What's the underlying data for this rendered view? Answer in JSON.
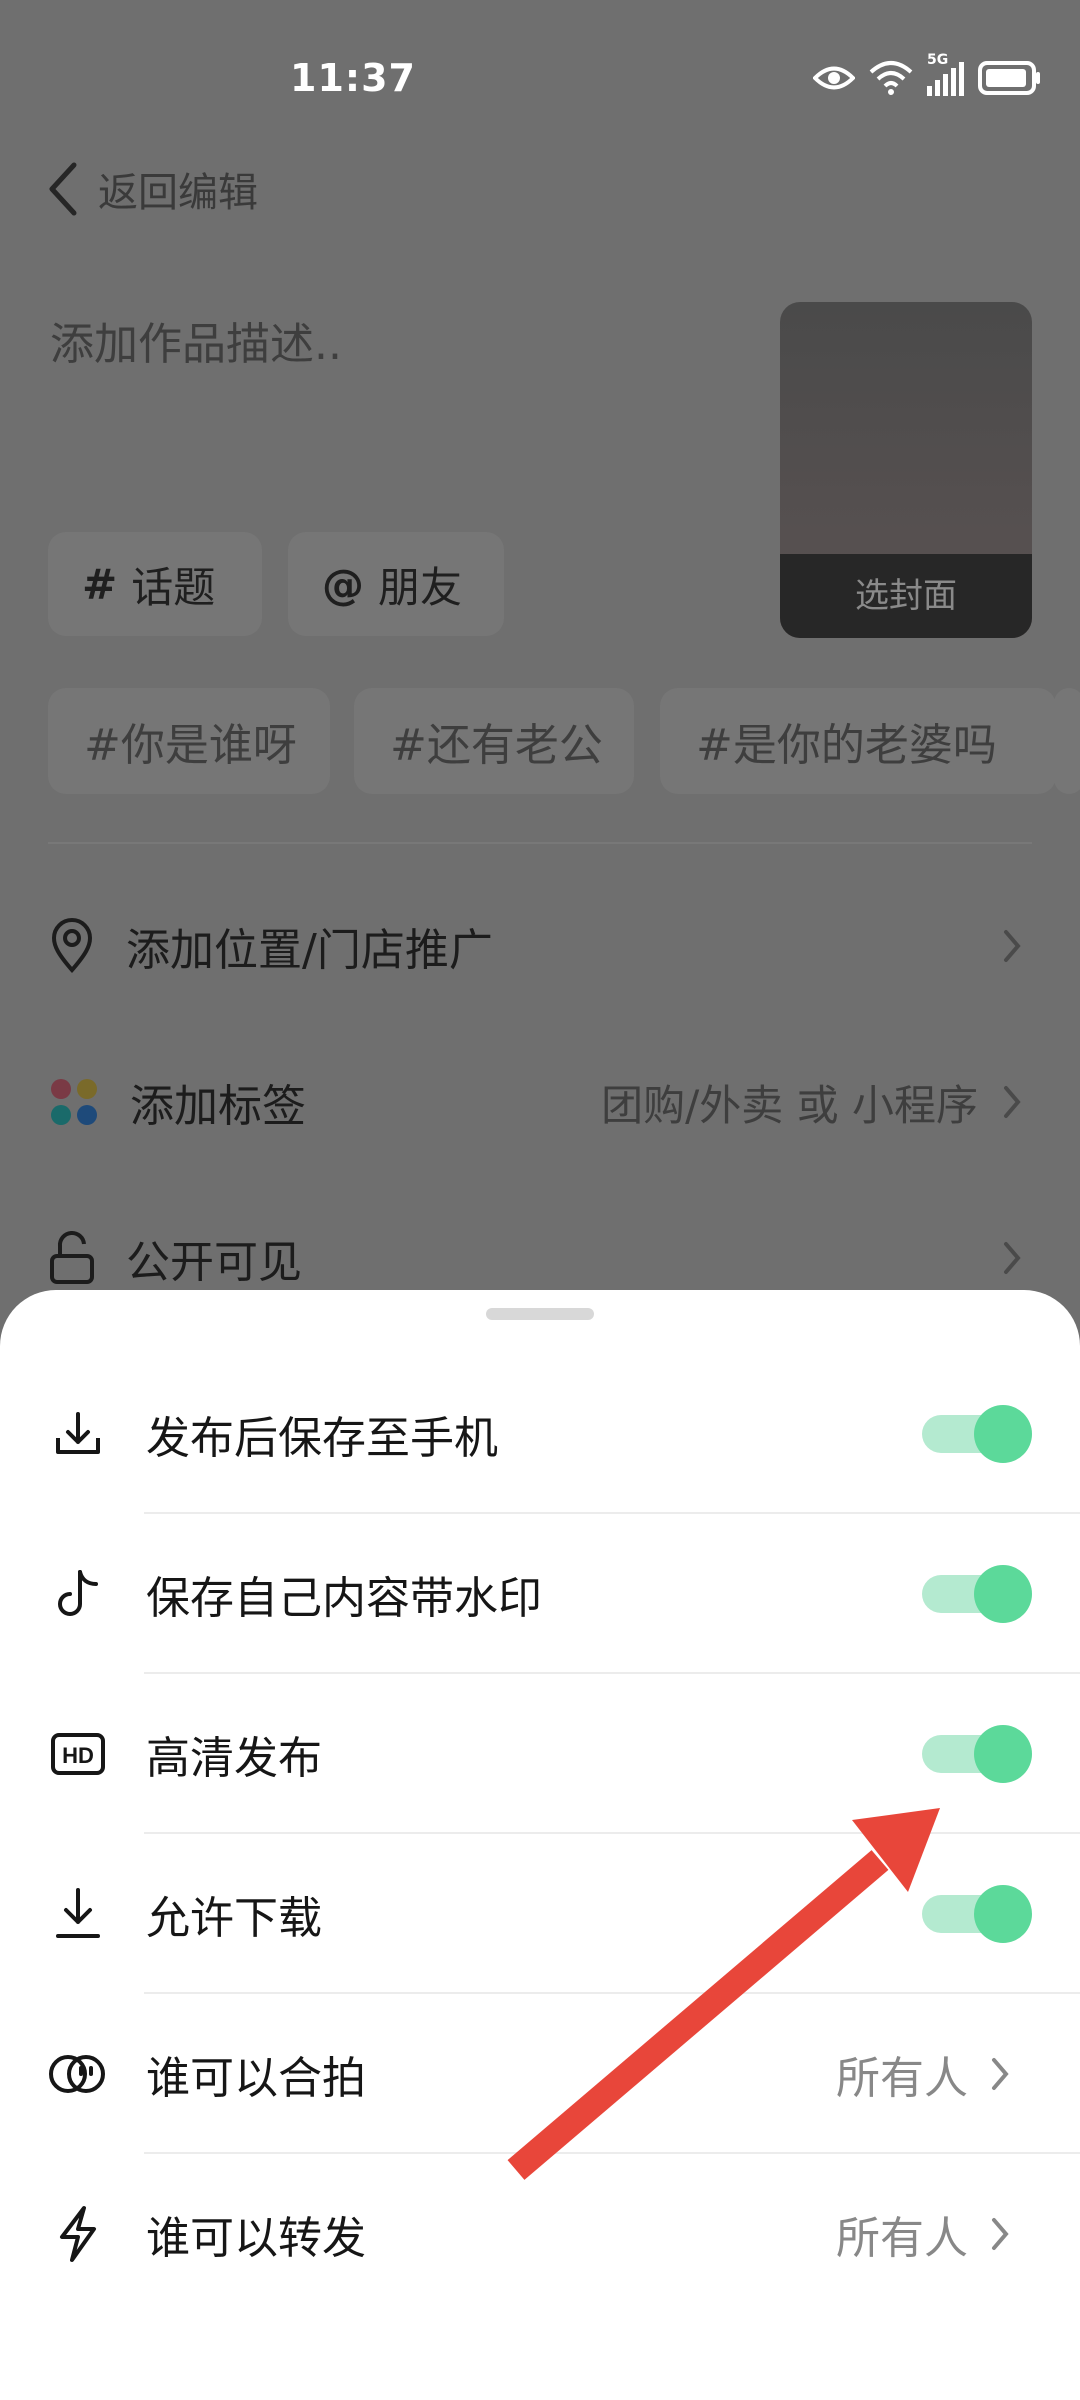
{
  "status_bar": {
    "time": "11:37",
    "network": "5G"
  },
  "header": {
    "back_label": "返回编辑"
  },
  "description": {
    "placeholder": "添加作品描述.."
  },
  "cover": {
    "label": "选封面"
  },
  "chips": [
    {
      "symbol": "#",
      "label": "话题"
    },
    {
      "symbol": "@",
      "label": "朋友"
    }
  ],
  "suggested_tags": [
    "#你是谁呀",
    "#还有老公",
    "#是你的老婆吗"
  ],
  "options": [
    {
      "label": "添加位置/门店推广",
      "value": ""
    },
    {
      "label": "添加标签",
      "value": "团购/外卖 或 小程序"
    },
    {
      "label": "公开可见",
      "value": ""
    }
  ],
  "sheet": {
    "toggle_rows": [
      {
        "label": "发布后保存至手机",
        "on": true
      },
      {
        "label": "保存自己内容带水印",
        "on": true
      },
      {
        "label": "高清发布",
        "on": true
      },
      {
        "label": "允许下载",
        "on": true
      }
    ],
    "value_rows": [
      {
        "label": "谁可以合拍",
        "value": "所有人"
      },
      {
        "label": "谁可以转发",
        "value": "所有人"
      }
    ]
  },
  "colors": {
    "toggle_on": "#5cd99a",
    "toggle_track": "#b4ead0",
    "annotation_arrow": "#e8463a"
  }
}
